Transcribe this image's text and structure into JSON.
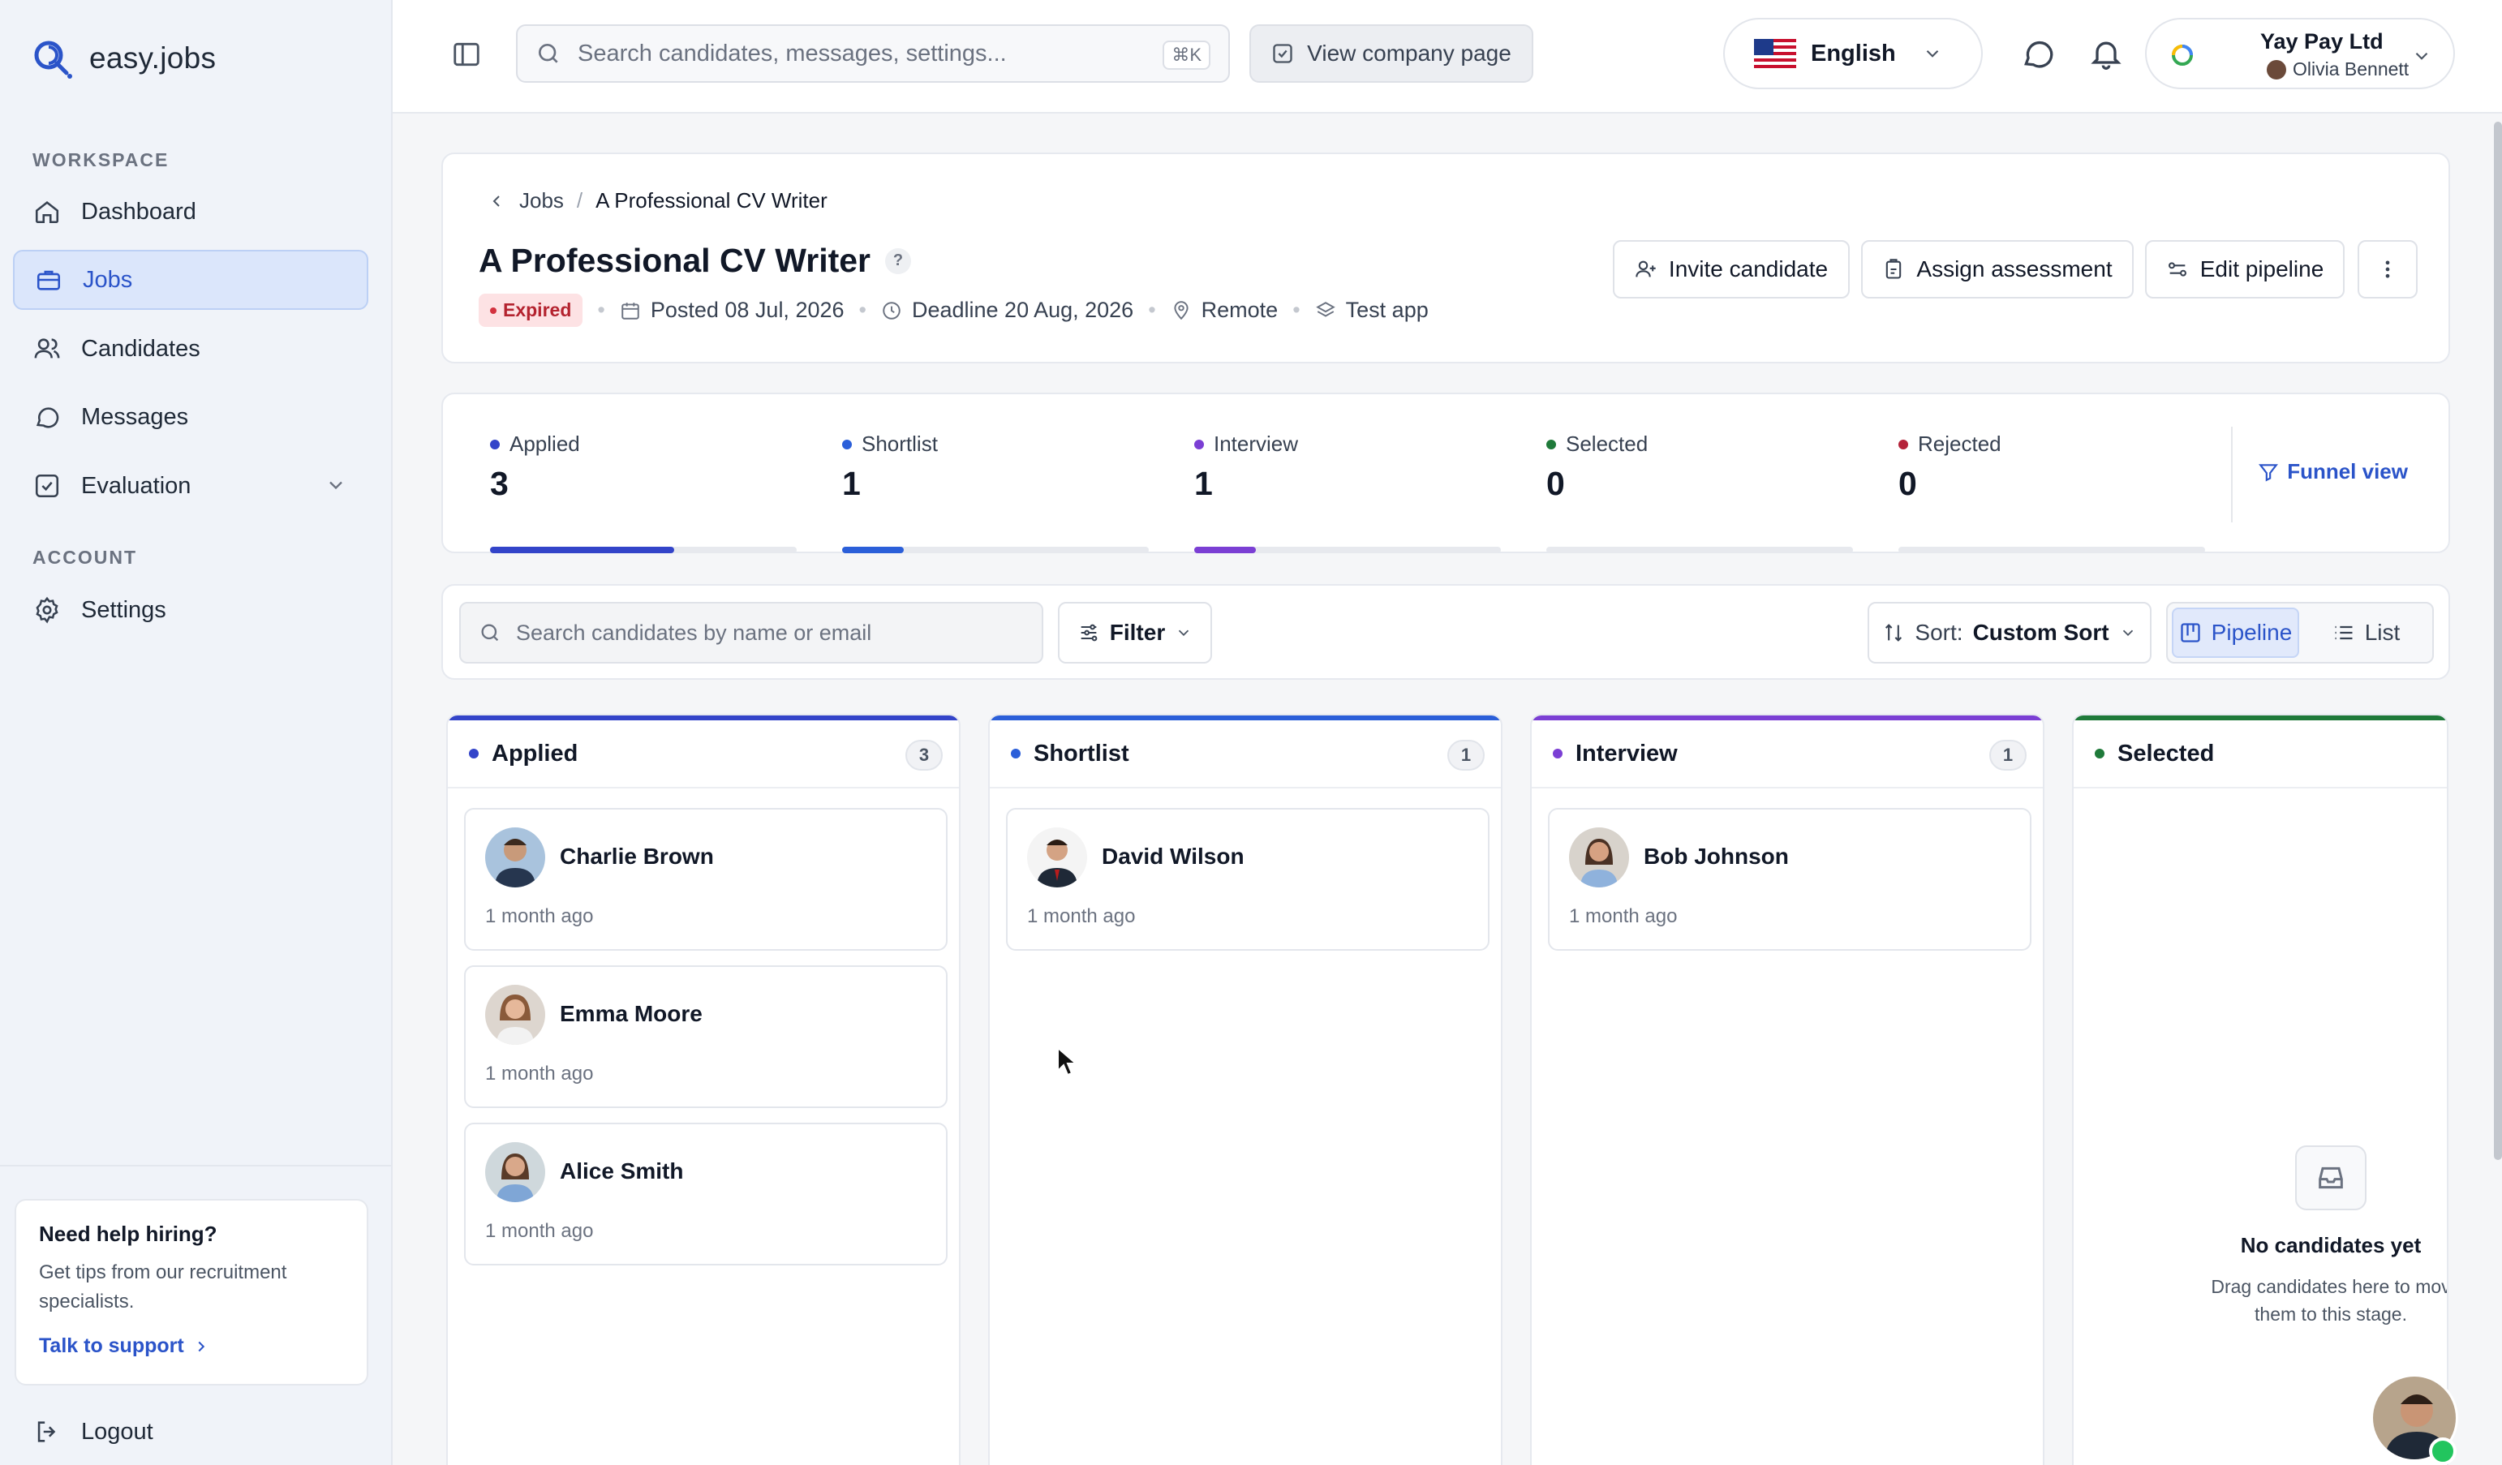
{
  "app": {
    "name": "easy.jobs"
  },
  "sidebar": {
    "workspace_label": "WORKSPACE",
    "account_label": "ACCOUNT",
    "items": [
      {
        "label": "Dashboard",
        "icon": "home-icon"
      },
      {
        "label": "Jobs",
        "icon": "briefcase-icon",
        "active": true
      },
      {
        "label": "Candidates",
        "icon": "users-icon"
      },
      {
        "label": "Messages",
        "icon": "chat-icon"
      },
      {
        "label": "Evaluation",
        "icon": "checklist-icon"
      }
    ],
    "settings": {
      "label": "Settings",
      "icon": "gear-icon"
    },
    "help": {
      "title": "Need help hiring?",
      "text": "Get tips from our recruitment specialists.",
      "link": "Talk to support"
    },
    "logout": "Logout"
  },
  "topbar": {
    "search_placeholder": "Search candidates, messages, settings...",
    "shortcut": "⌘K",
    "company_page": "View company page",
    "language": "English",
    "account": {
      "company": "Yay Pay Ltd",
      "user": "Olivia Bennett"
    }
  },
  "job": {
    "breadcrumb_parent": "Jobs",
    "breadcrumb_current": "A Professional CV Writer",
    "title": "A Professional CV Writer",
    "help": "?",
    "status": "Expired",
    "posted": "Posted 08 Jul, 2026",
    "deadline": "Deadline 20 Aug, 2026",
    "location": "Remote",
    "app": "Test app",
    "actions": {
      "invite": "Invite candidate",
      "assess": "Assign assessment",
      "edit": "Edit pipeline"
    }
  },
  "stats": [
    {
      "label": "Applied",
      "value": "3",
      "color": "#3344c9",
      "progress": 0.6
    },
    {
      "label": "Shortlist",
      "value": "1",
      "color": "#2b5fd9",
      "progress": 0.2
    },
    {
      "label": "Interview",
      "value": "1",
      "color": "#7b3fd4",
      "progress": 0.2
    },
    {
      "label": "Selected",
      "value": "0",
      "color": "#1f7a3a",
      "progress": 0
    },
    {
      "label": "Rejected",
      "value": "0",
      "color": "#b4233a",
      "progress": 0
    }
  ],
  "funnel_view": "Funnel view",
  "toolbar": {
    "search_placeholder": "Search candidates by name or email",
    "filter": "Filter",
    "sort_label": "Sort:",
    "sort_value": "Custom Sort",
    "pipeline": "Pipeline",
    "list": "List"
  },
  "columns": [
    {
      "name": "Applied",
      "count": "3",
      "color": "#3344c9",
      "cards": [
        {
          "name": "Charlie Brown",
          "time": "1 month ago"
        },
        {
          "name": "Emma Moore",
          "time": "1 month ago"
        },
        {
          "name": "Alice Smith",
          "time": "1 month ago"
        }
      ]
    },
    {
      "name": "Shortlist",
      "count": "1",
      "color": "#2b5fd9",
      "cards": [
        {
          "name": "David Wilson",
          "time": "1 month ago"
        }
      ]
    },
    {
      "name": "Interview",
      "count": "1",
      "color": "#7b3fd4",
      "cards": [
        {
          "name": "Bob Johnson",
          "time": "1 month ago"
        }
      ]
    },
    {
      "name": "Selected",
      "count": "",
      "color": "#1f7a3a",
      "cards": []
    }
  ],
  "empty_state": {
    "title": "No candidates yet",
    "line1": "Drag candidates here to mov",
    "line2": "them to this stage."
  }
}
